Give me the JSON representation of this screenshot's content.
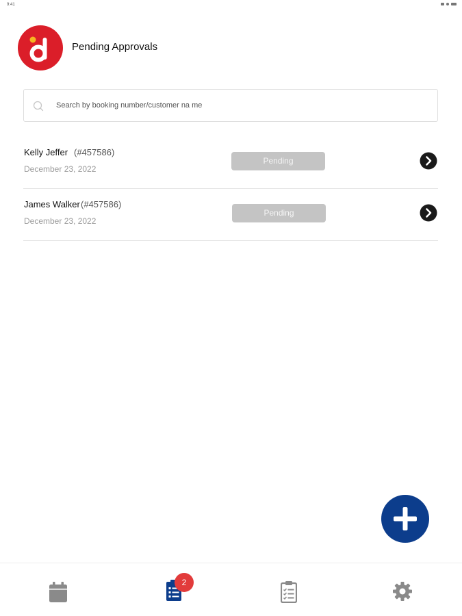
{
  "status_bar": {
    "time": "9:41"
  },
  "header": {
    "title": "Pending Approvals"
  },
  "search": {
    "placeholder": "Search by booking number/customer na me"
  },
  "approvals": [
    {
      "name": "Kelly Jeffer",
      "booking": "(#457586)",
      "date": "December 23, 2022",
      "status": "Pending"
    },
    {
      "name": "James Walker",
      "booking": "(#457586)",
      "date": "December 23, 2022",
      "status": "Pending"
    }
  ],
  "bottom_nav": {
    "items": [
      {
        "icon": "calendar-icon",
        "active": false
      },
      {
        "icon": "list-icon",
        "active": true,
        "badge": "2"
      },
      {
        "icon": "clipboard-icon",
        "active": false
      },
      {
        "icon": "gear-icon",
        "active": false
      }
    ]
  },
  "fab": {
    "icon": "plus-icon"
  },
  "colors": {
    "brand_red": "#db1e29",
    "primary_blue": "#0c3d8c",
    "badge_red": "#e23b3b",
    "status_pending": "#c4c4c4",
    "nav_inactive": "#8a8a8a"
  }
}
